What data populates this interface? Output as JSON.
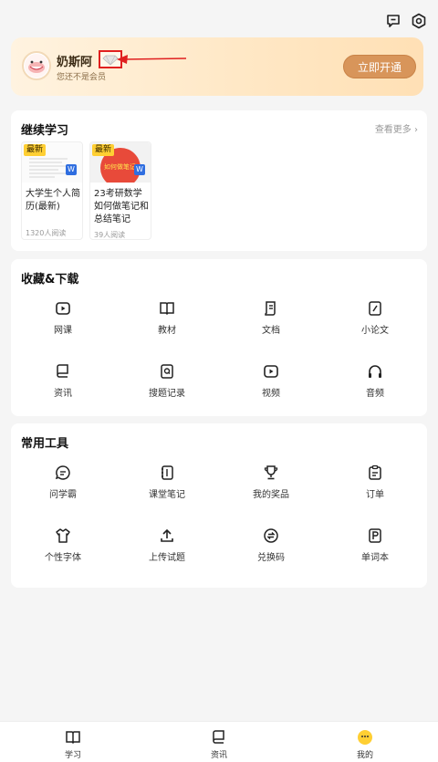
{
  "header": {
    "message_icon": "message-icon",
    "settings_icon": "settings-icon"
  },
  "vip": {
    "username": "奶斯阿",
    "status": "您还不是会员",
    "open_button": "立即开通",
    "badge_icon": "diamond-icon"
  },
  "continue_study": {
    "title": "继续学习",
    "more": "查看更多 ›",
    "items": [
      {
        "tag": "最新",
        "title": "大学生个人简历(最新)",
        "reads": "1320人阅读"
      },
      {
        "tag": "最新",
        "title": "23考研数学如何做笔记和总结笔记",
        "reads": "39人阅读",
        "cover_text": "如何做笔记"
      }
    ]
  },
  "favorites": {
    "title": "收藏&下载",
    "items": [
      {
        "label": "网课",
        "icon": "video-course-icon"
      },
      {
        "label": "教材",
        "icon": "book-icon"
      },
      {
        "label": "文档",
        "icon": "document-icon"
      },
      {
        "label": "小论文",
        "icon": "pen-icon"
      },
      {
        "label": "资讯",
        "icon": "news-icon"
      },
      {
        "label": "搜题记录",
        "icon": "search-record-icon"
      },
      {
        "label": "视频",
        "icon": "video-icon"
      },
      {
        "label": "音频",
        "icon": "headphones-icon"
      }
    ]
  },
  "tools": {
    "title": "常用工具",
    "items": [
      {
        "label": "问学霸",
        "icon": "chat-icon"
      },
      {
        "label": "课堂笔记",
        "icon": "notebook-icon"
      },
      {
        "label": "我的奖品",
        "icon": "trophy-icon"
      },
      {
        "label": "订单",
        "icon": "clipboard-icon"
      },
      {
        "label": "个性字体",
        "icon": "tshirt-icon"
      },
      {
        "label": "上传试题",
        "icon": "upload-icon"
      },
      {
        "label": "兑换码",
        "icon": "exchange-icon"
      },
      {
        "label": "单词本",
        "icon": "wordbook-icon"
      }
    ]
  },
  "tabbar": {
    "items": [
      {
        "label": "学习",
        "icon": "study-icon"
      },
      {
        "label": "资讯",
        "icon": "news-tab-icon"
      },
      {
        "label": "我的",
        "icon": "profile-icon",
        "active": true
      }
    ]
  },
  "colors": {
    "accent": "#d8955a",
    "vip_gradient_start": "#fff3e0",
    "vip_gradient_end": "#ffe0b5",
    "active_tab": "#ffcf33"
  }
}
